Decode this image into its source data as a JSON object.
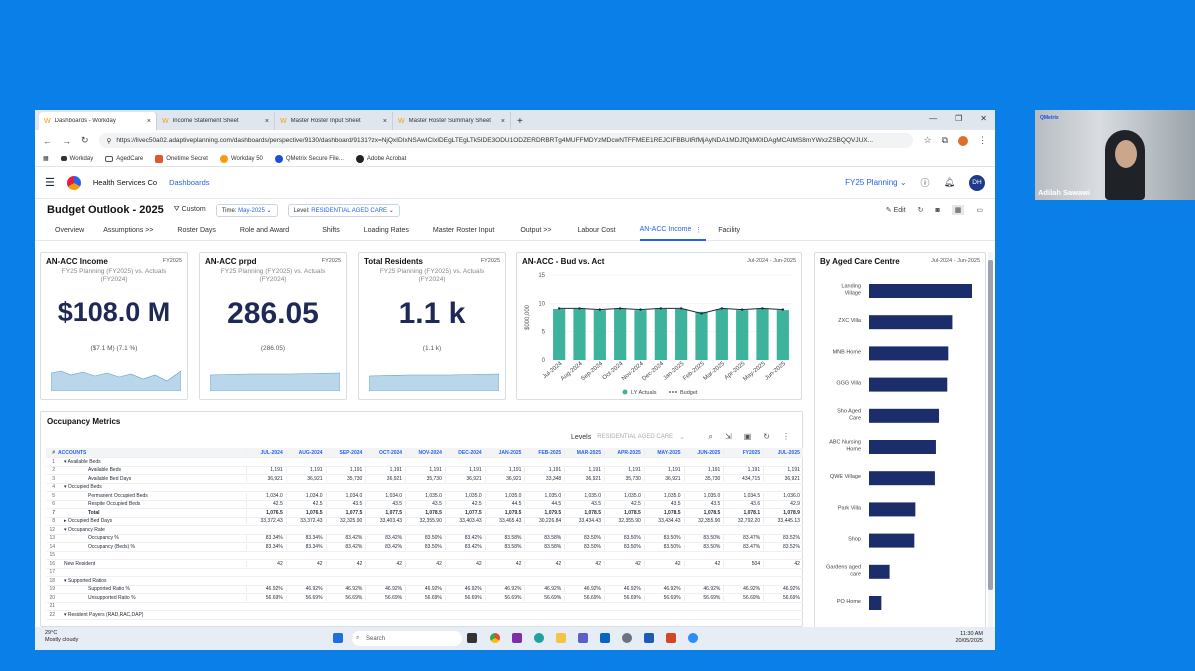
{
  "browser": {
    "tabs": [
      {
        "label": "Dashboards - Workday"
      },
      {
        "label": "Income Statement Sheet"
      },
      {
        "label": "Master Roster Input Sheet"
      },
      {
        "label": "Master Roster Summary Sheet"
      }
    ],
    "url": "https://livec50a02.adaptiveplanning.com/dashboards/perspective/9130/dashboard/9131?zx=NjQxIDIxNSAwICIxIDEgLTEgLTk5IDE3ODU1ODZERDRBRTg4MUFFMDYzMDcwNTFFMEE1REJCIFBBUlRfMjAyNDA1MDJfQkM0IDAgMCAtMS8mYWxzZSBQQVJUX...",
    "bookmarks": [
      "Workday",
      "AgedCare",
      "Onetime Secret",
      "Workday 50",
      "QMetrix Secure File...",
      "Adobe Acrobat"
    ]
  },
  "app": {
    "company": "Health Services Co",
    "breadcrumb": "Dashboards",
    "plan": "FY25 Planning",
    "avatar": "DH",
    "page_title": "Budget Outlook - 2025",
    "custom_label": "Custom",
    "time_filter_label": "Time:",
    "time_filter_value": "May-2025",
    "level_filter_label": "Level:",
    "level_filter_value": "RESIDENTIAL AGED CARE",
    "edit_label": "Edit",
    "tabs": [
      "Overview",
      "Assumptions >>",
      "Roster Days",
      "Role and Award",
      "Shifts",
      "Loading Rates",
      "Master Roster Input",
      "Output >>",
      "Labour Cost",
      "AN-ACC Income",
      "Facility"
    ],
    "active_tab": "AN-ACC Income"
  },
  "kpis": [
    {
      "title": "AN-ACC Income",
      "period": "FY2025",
      "subtitle": "FY25 Planning (FY2025) vs. Actuals (FY2024)",
      "value": "$108.0 M",
      "variance": "($7.1 M)   (7.1 %)"
    },
    {
      "title": "AN-ACC prpd",
      "period": "FY2025",
      "subtitle": "FY25 Planning (FY2025) vs. Actuals (FY2024)",
      "value": "286.05",
      "variance": "(286.05)"
    },
    {
      "title": "Total Residents",
      "period": "FY2025",
      "subtitle": "FY25 Planning (FY2025) vs. Actuals (FY2024)",
      "value": "1.1 k",
      "variance": "(1.1 k)"
    }
  ],
  "bud_chart": {
    "title": "AN-ACC - Bud vs. Act",
    "period": "Jul-2024 - Jun-2025",
    "legend": [
      "LY Actuals",
      "Budget"
    ],
    "colors": {
      "bars": "#3db39b",
      "line": "#1f2937"
    }
  },
  "facility_chart": {
    "title": "By Aged Care Centre",
    "period": "Jul-2024 - Jun-2025",
    "color": "#1b2e6b"
  },
  "chart_data": [
    {
      "type": "bar",
      "title": "AN-ACC - Bud vs. Act",
      "ylabel": "$000,000",
      "ylim": [
        0,
        15
      ],
      "yticks": [
        "0",
        "5",
        "10",
        "15"
      ],
      "categories": [
        "Jul-2024",
        "Aug-2024",
        "Sep-2024",
        "Oct-2024",
        "Nov-2024",
        "Dec-2024",
        "Jan-2025",
        "Feb-2025",
        "Mar-2025",
        "Apr-2025",
        "May-2025",
        "Jun-2025"
      ],
      "series": [
        {
          "name": "LY Actuals",
          "type": "bar",
          "values": [
            9.0,
            9.0,
            8.8,
            9.0,
            8.8,
            9.0,
            9.0,
            8.5,
            9.0,
            8.8,
            9.0,
            8.8
          ]
        },
        {
          "name": "Budget",
          "type": "line",
          "values": [
            9.1,
            9.1,
            8.9,
            9.1,
            8.9,
            9.1,
            9.1,
            8.2,
            9.1,
            8.9,
            9.1,
            8.9
          ]
        }
      ]
    },
    {
      "type": "bar",
      "orientation": "horizontal",
      "title": "By Aged Care Centre",
      "categories": [
        "Landing Village",
        "ZXC Villa",
        "MNB Home",
        "GGG Villa",
        "Sho Aged Care",
        "ABC Nursing Home",
        "QWE Village",
        "Park Villa",
        "Shop",
        "Gardens aged care",
        "PO Home"
      ],
      "values": [
        100,
        81,
        77,
        76,
        68,
        65,
        64,
        45,
        44,
        20,
        12
      ]
    }
  ],
  "occupancy": {
    "title": "Occupancy Metrics",
    "levels_label": "Levels",
    "levels_value": "RESIDENTIAL AGED CARE",
    "headers": [
      "#",
      "ACCOUNTS",
      "JUL-2024",
      "AUG-2024",
      "SEP-2024",
      "OCT-2024",
      "NOV-2024",
      "DEC-2024",
      "JAN-2025",
      "FEB-2025",
      "MAR-2025",
      "APR-2025",
      "MAY-2025",
      "JUN-2025",
      "FY2025",
      "JUL-2025"
    ],
    "rows": [
      [
        "1",
        "▾ Available Beds",
        "",
        "",
        "",
        "",
        "",
        "",
        "",
        "",
        "",
        "",
        "",
        "",
        "",
        ""
      ],
      [
        "2",
        "Available Beds",
        "1,191",
        "1,191",
        "1,191",
        "1,191",
        "1,191",
        "1,191",
        "1,191",
        "1,191",
        "1,191",
        "1,191",
        "1,191",
        "1,191",
        "1,191",
        "1,191"
      ],
      [
        "3",
        "Available Bed Days",
        "36,921",
        "36,921",
        "35,730",
        "36,921",
        "35,730",
        "36,921",
        "36,921",
        "33,348",
        "36,921",
        "35,730",
        "36,921",
        "35,730",
        "434,715",
        "36,921"
      ],
      [
        "4",
        "▾ Occupied Beds",
        "",
        "",
        "",
        "",
        "",
        "",
        "",
        "",
        "",
        "",
        "",
        "",
        "",
        ""
      ],
      [
        "5",
        "Permanent Occupied Beds",
        "1,034.0",
        "1,034.0",
        "1,034.0",
        "1,034.0",
        "1,035.0",
        "1,035.0",
        "1,035.0",
        "1,035.0",
        "1,035.0",
        "1,035.0",
        "1,035.0",
        "1,035.0",
        "1,034.5",
        "1,036.0"
      ],
      [
        "6",
        "Respite Occupied Beds",
        "42.5",
        "42.5",
        "43.5",
        "43.5",
        "43.5",
        "42.5",
        "44.5",
        "44.5",
        "43.5",
        "42.5",
        "43.5",
        "43.5",
        "43.6",
        "42.9"
      ],
      [
        "7",
        "Total",
        "1,076.5",
        "1,076.5",
        "1,077.5",
        "1,077.5",
        "1,078.5",
        "1,077.5",
        "1,079.5",
        "1,079.5",
        "1,078.5",
        "1,078.5",
        "1,078.5",
        "1,078.5",
        "1,078.1",
        "1,078.9"
      ],
      [
        "8",
        "▸ Occupied Bed Days",
        "33,372.43",
        "33,372.43",
        "32,325.90",
        "33,403.43",
        "32,355.90",
        "33,403.43",
        "33,465.43",
        "30,226.84",
        "33,434.43",
        "32,355.90",
        "33,434.43",
        "32,355.90",
        "32,792.20",
        "33,445.13"
      ],
      [
        "12",
        "▾ Occupancy Rate",
        "",
        "",
        "",
        "",
        "",
        "",
        "",
        "",
        "",
        "",
        "",
        "",
        "",
        ""
      ],
      [
        "13",
        "Occupancy %",
        "83.34%",
        "83.34%",
        "83.42%",
        "83.42%",
        "83.50%",
        "83.42%",
        "83.58%",
        "83.58%",
        "83.50%",
        "83.50%",
        "83.50%",
        "83.50%",
        "83.47%",
        "83.52%"
      ],
      [
        "14",
        "Occupancy (Beds) %",
        "83.34%",
        "83.34%",
        "83.42%",
        "83.42%",
        "83.50%",
        "83.42%",
        "83.58%",
        "83.58%",
        "83.50%",
        "83.50%",
        "83.50%",
        "83.50%",
        "83.47%",
        "83.52%"
      ],
      [
        "15",
        "",
        "",
        "",
        "",
        "",
        "",
        "",
        "",
        "",
        "",
        "",
        "",
        "",
        "",
        ""
      ],
      [
        "16",
        "New Resident",
        "42",
        "42",
        "42",
        "42",
        "42",
        "42",
        "42",
        "42",
        "42",
        "42",
        "42",
        "42",
        "504",
        "42"
      ],
      [
        "17",
        "",
        "",
        "",
        "",
        "",
        "",
        "",
        "",
        "",
        "",
        "",
        "",
        "",
        "",
        ""
      ],
      [
        "18",
        "▾ Supported Ratios",
        "",
        "",
        "",
        "",
        "",
        "",
        "",
        "",
        "",
        "",
        "",
        "",
        "",
        ""
      ],
      [
        "19",
        "Supported Ratio %",
        "46.92%",
        "46.92%",
        "46.92%",
        "46.92%",
        "46.92%",
        "46.92%",
        "46.92%",
        "46.92%",
        "46.92%",
        "46.92%",
        "46.92%",
        "46.92%",
        "46.92%",
        "46.92%"
      ],
      [
        "20",
        "Unsupported Ratio %",
        "56.69%",
        "56.69%",
        "56.69%",
        "56.69%",
        "56.69%",
        "56.69%",
        "56.69%",
        "56.69%",
        "56.69%",
        "56.69%",
        "56.69%",
        "56.69%",
        "56.69%",
        "56.69%"
      ],
      [
        "21",
        "",
        "",
        "",
        "",
        "",
        "",
        "",
        "",
        "",
        "",
        "",
        "",
        "",
        "",
        ""
      ],
      [
        "22",
        "▾ Resident Payers (RAD,RAC,DAP)",
        "",
        "",
        "",
        "",
        "",
        "",
        "",
        "",
        "",
        "",
        "",
        "",
        "",
        ""
      ]
    ]
  },
  "taskbar": {
    "temp": "29°C",
    "weather": "Mostly cloudy",
    "search": "Search",
    "time": "11:30 AM",
    "date": "20/05/2025"
  },
  "video": {
    "name": "Adilah Sawawi",
    "brand": "QMetrix"
  }
}
